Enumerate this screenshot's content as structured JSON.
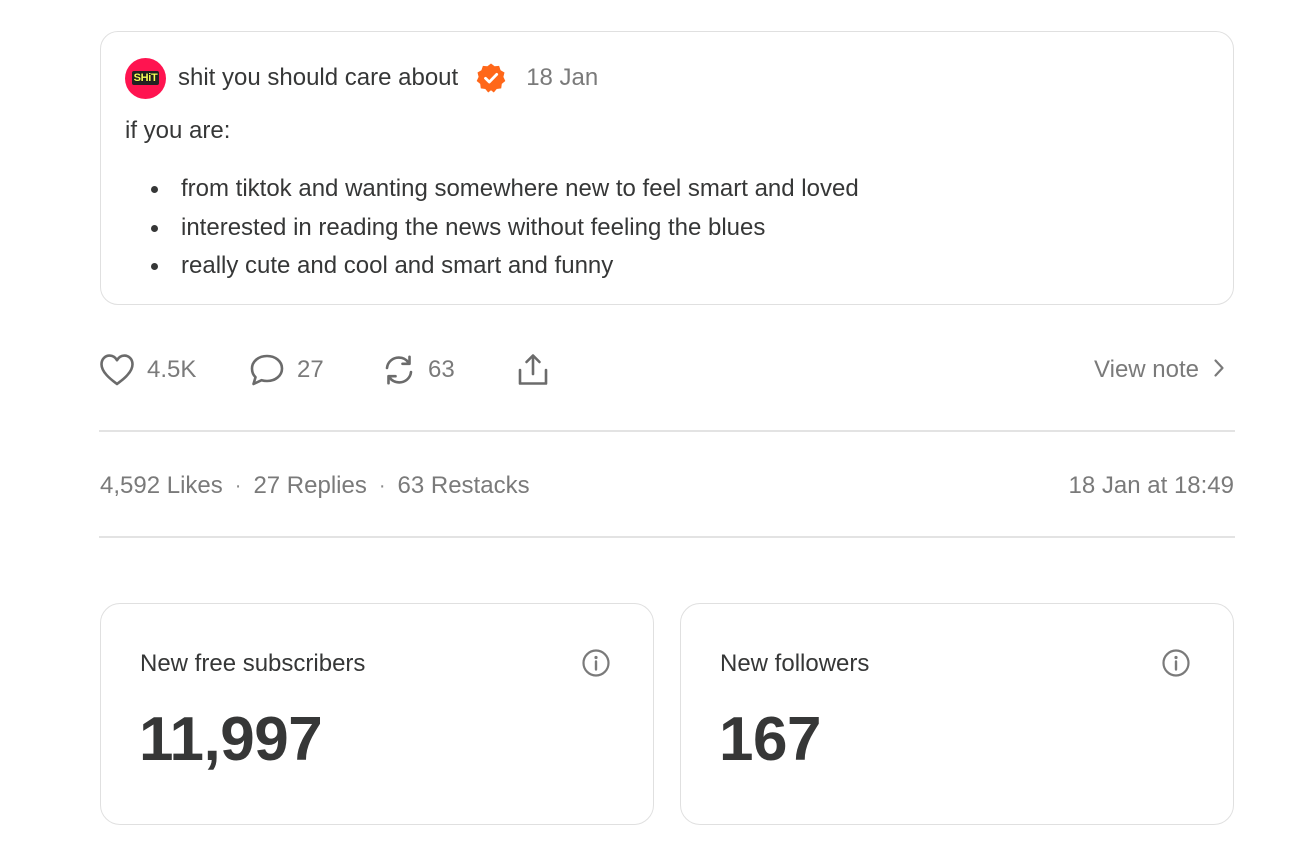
{
  "note": {
    "avatar_text": "SHiT",
    "author": "shit you should care about",
    "verified_icon": "verified-badge-icon",
    "date": "18 Jan",
    "intro": "if you are:",
    "bullets": [
      "from tiktok and wanting somewhere new to feel smart and loved",
      "interested in reading the news without feeling the blues",
      "really cute and cool and smart and funny"
    ]
  },
  "actions": {
    "likes": "4.5K",
    "replies": "27",
    "restacks": "63",
    "view_note": "View note"
  },
  "stats": {
    "likes": "4,592 Likes",
    "replies": "27 Replies",
    "restacks": "63 Restacks",
    "separator": "·",
    "timestamp": "18 Jan at 18:49"
  },
  "metrics": [
    {
      "label": "New free subscribers",
      "value": "11,997"
    },
    {
      "label": "New followers",
      "value": "167"
    }
  ],
  "colors": {
    "accent": "#ff6719",
    "avatar_bg": "#ff1450",
    "text": "#363737",
    "muted": "#7a7a7a",
    "border": "#e0e0e0"
  }
}
